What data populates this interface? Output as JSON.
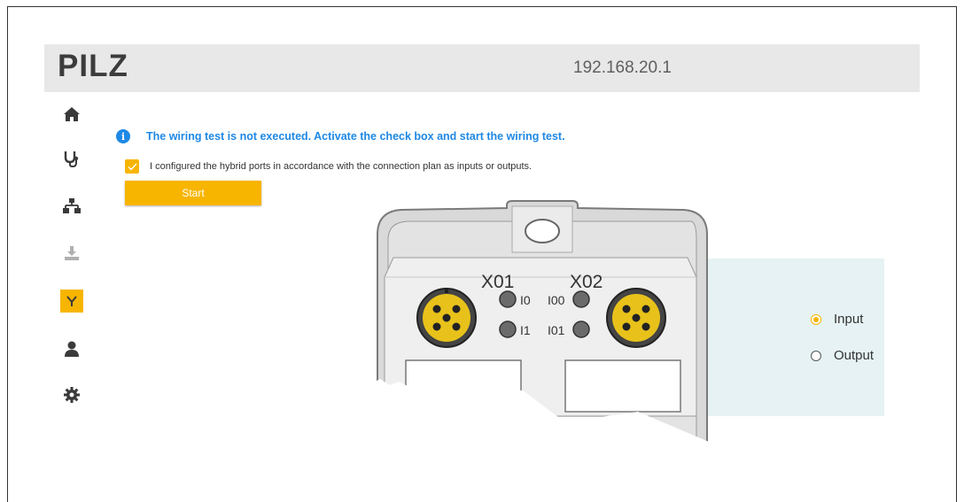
{
  "header": {
    "brand": "PILZ",
    "ip_address": "192.168.20.1"
  },
  "sidebar": {
    "items": [
      {
        "name": "home",
        "icon": "home-icon",
        "active": false
      },
      {
        "name": "diagnostics",
        "icon": "stethoscope-icon",
        "active": false
      },
      {
        "name": "network",
        "icon": "network-icon",
        "active": false
      },
      {
        "name": "download",
        "icon": "download-icon",
        "active": false
      },
      {
        "name": "wiring-test",
        "icon": "wiring-icon",
        "active": true
      },
      {
        "name": "user",
        "icon": "user-icon",
        "active": false
      },
      {
        "name": "settings",
        "icon": "gear-icon",
        "active": false
      }
    ]
  },
  "alert": {
    "text": "The wiring test is not executed. Activate the check box and start the wiring test."
  },
  "confirm": {
    "checked": true,
    "label": "I configured the hybrid ports in accordance with the connection plan as inputs or outputs."
  },
  "start_button": {
    "label": "Start"
  },
  "device": {
    "port_left": "X01",
    "port_right": "X02",
    "led_labels_left": [
      "I0",
      "I1"
    ],
    "led_labels_right": [
      "I00",
      "I01"
    ]
  },
  "port_mode": {
    "options": [
      {
        "label": "Input",
        "selected": true
      },
      {
        "label": "Output",
        "selected": false
      }
    ]
  },
  "colors": {
    "accent": "#f7b500",
    "info": "#1e88e5",
    "header_bg": "#e8e8e8",
    "panel_bg": "#e6f2f3"
  }
}
